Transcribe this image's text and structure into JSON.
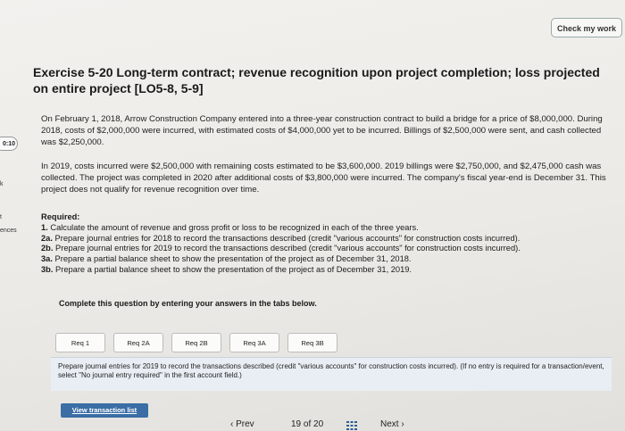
{
  "header": {
    "check_button": "Check my work"
  },
  "sidebar_edge": {
    "timer": "0:10",
    "fragments": [
      "k",
      "t",
      "ences"
    ]
  },
  "exercise": {
    "title": "Exercise 5-20 Long-term contract; revenue recognition upon project completion; loss projected on entire project [LO5-8, 5-9]",
    "paragraph1": "On February 1, 2018, Arrow Construction Company entered into a three-year construction contract to build a bridge for a price of $8,000,000. During 2018, costs of $2,000,000 were incurred, with estimated costs of $4,000,000 yet to be incurred. Billings of $2,500,000 were sent, and cash collected was $2,250,000.",
    "paragraph2": "In 2019, costs incurred were $2,500,000 with remaining costs estimated to be $3,600,000. 2019 billings were $2,750,000, and $2,475,000 cash was collected. The project was completed in 2020 after additional costs of $3,800,000 were incurred. The company's fiscal year-end is December 31. This project does not qualify for revenue recognition over time."
  },
  "required": {
    "heading": "Required:",
    "items": [
      {
        "num": "1.",
        "text": "Calculate the amount of revenue and gross profit or loss to be recognized in each of the three years."
      },
      {
        "num": "2a.",
        "text": "Prepare journal entries for 2018 to record the transactions described (credit \"various accounts\" for construction costs incurred)."
      },
      {
        "num": "2b.",
        "text": "Prepare journal entries for 2019 to record the transactions described (credit \"various accounts\" for construction costs incurred)."
      },
      {
        "num": "3a.",
        "text": "Prepare a partial balance sheet to show the presentation of the project as of December 31, 2018."
      },
      {
        "num": "3b.",
        "text": "Prepare a partial balance sheet to show the presentation of the project as of December 31, 2019."
      }
    ]
  },
  "answer_area": {
    "complete_label": "Complete this question by entering your answers in the tabs below.",
    "tabs": [
      "Req 1",
      "Req 2A",
      "Req 2B",
      "Req 3A",
      "Req 3B"
    ],
    "instruction": "Prepare journal entries for 2019 to record the transactions described (credit \"various accounts\" for construction costs incurred). (If no entry is required for a transaction/event, select \"No journal entry required\" in the first account field.)",
    "view_button": "View transaction list"
  },
  "footer": {
    "prev_label": "Prev",
    "current_page": "19",
    "of_label": "of",
    "total_pages": "20",
    "next_label": "Next"
  }
}
